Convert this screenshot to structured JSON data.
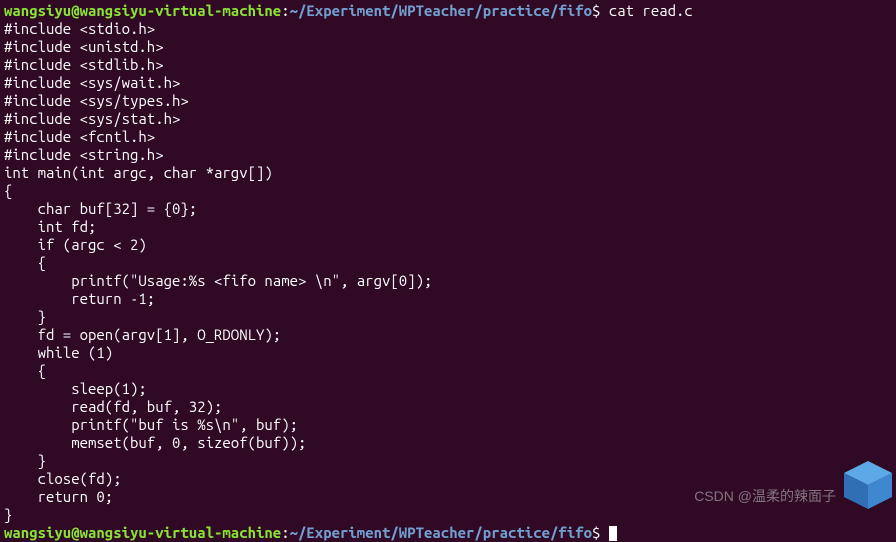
{
  "prompt1": {
    "user": "wangsiyu@wangsiyu-virtual-machine",
    "colon": ":",
    "path": "~/Experiment/WPTeacher/practice/fifo",
    "dollar": "$ ",
    "command": "cat read.c"
  },
  "code": [
    "#include <stdio.h>",
    "#include <unistd.h>",
    "#include <stdlib.h>",
    "#include <sys/wait.h>",
    "#include <sys/types.h>",
    "#include <sys/stat.h>",
    "#include <fcntl.h>",
    "#include <string.h>",
    "int main(int argc, char *argv[])",
    "{",
    "    char buf[32] = {0};",
    "    int fd;",
    "    if (argc < 2)",
    "    {",
    "        printf(\"Usage:%s <fifo name> \\n\", argv[0]);",
    "        return -1;",
    "    }",
    "    fd = open(argv[1], O_RDONLY);",
    "    while (1)",
    "    {",
    "        sleep(1);",
    "        read(fd, buf, 32);",
    "        printf(\"buf is %s\\n\", buf);",
    "        memset(buf, 0, sizeof(buf));",
    "    }",
    "    close(fd);",
    "    return 0;",
    "}"
  ],
  "prompt2": {
    "user": "wangsiyu@wangsiyu-virtual-machine",
    "colon": ":",
    "path": "~/Experiment/WPTeacher/practice/fifo",
    "dollar": "$ "
  },
  "watermark": "CSDN @温柔的辣面子"
}
